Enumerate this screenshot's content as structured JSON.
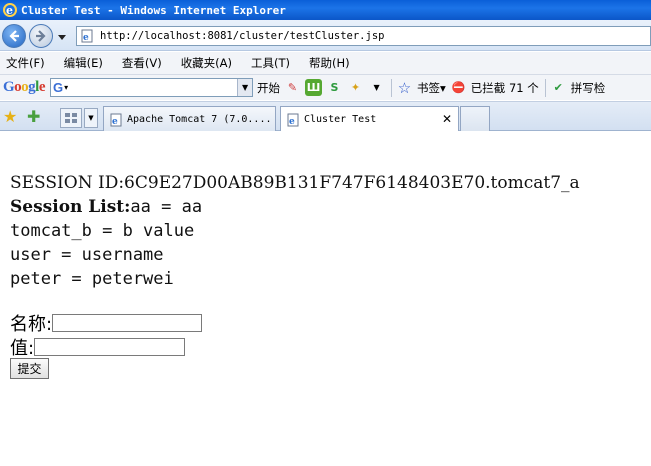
{
  "window": {
    "title": "Cluster Test - Windows Internet Explorer"
  },
  "address": {
    "url": "http://localhost:8081/cluster/testCluster.jsp"
  },
  "menu": [
    "文件(F)",
    "编辑(E)",
    "查看(V)",
    "收藏夹(A)",
    "工具(T)",
    "帮助(H)"
  ],
  "google_toolbar": {
    "logo": "Google",
    "search_prefix": "G",
    "start_label": "开始",
    "bookmarks_label": "书签▾",
    "blocked_label": "已拦截 71 个",
    "spell_label": "拼写检"
  },
  "tabs": [
    {
      "label": "Apache Tomcat 7 (7.0....",
      "active": false
    },
    {
      "label": "Cluster Test",
      "active": true
    }
  ],
  "content": {
    "session_id": "SESSION ID:6C9E27D00AB89B131F747F6148403E70.tomcat7_a",
    "session_list_label": "Session List:",
    "session_list_first": "aa = aa",
    "entries": [
      "tomcat_b = b value",
      "user = username",
      "peter = peterwei"
    ],
    "form": {
      "name_label": "名称:",
      "name_value": "",
      "value_label": "值:",
      "value_value": "",
      "submit_label": "提交"
    }
  },
  "colors": {
    "titlebar": "#0a5fd8",
    "accent": "#2265c2"
  }
}
